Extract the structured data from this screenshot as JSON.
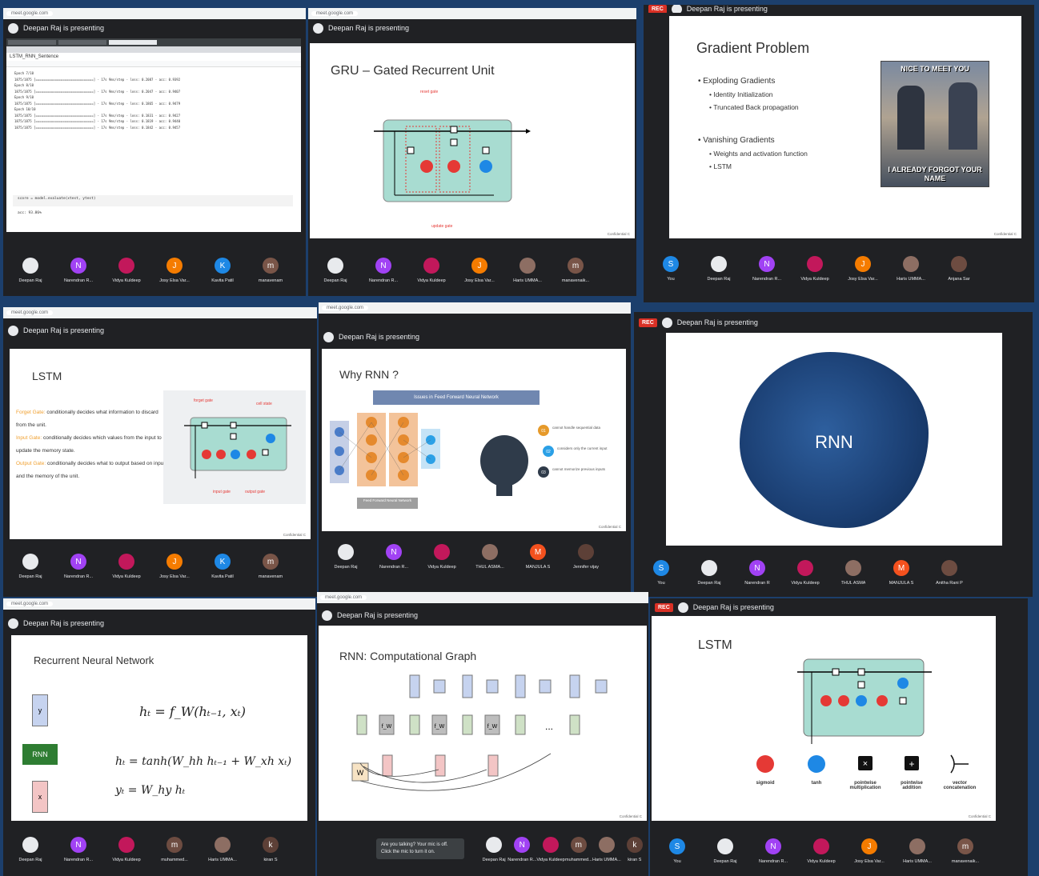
{
  "url": "meet.google.com",
  "presenting": "Deepan Raj is presenting",
  "rec": "REC",
  "confidential": "Confidential C",
  "colab": {
    "tabs": [
      "LSTM_RNN_Sentence",
      "LSTM_RNN_Sentence",
      "LSTM_RNN_Sentence"
    ],
    "notebook": "LSTM_RNN_Sentence",
    "lines": [
      "Epoch 7/10",
      "1875/1875 [==============================] - 17s 9ms/step - loss: 0.2087 - acc: 0.9392",
      "Epoch 8/10",
      "1875/1875 [==============================] - 17s 9ms/step - loss: 0.2047 - acc: 0.9407",
      "Epoch 9/10",
      "1875/1875 [==============================] - 17s 9ms/step - loss: 0.1865 - acc: 0.9479",
      "Epoch 10/10",
      "1875/1875 [==============================] - 17s 9ms/step - loss: 0.1831 - acc: 0.9427",
      "1875/1875 [==============================] - 17s 9ms/step - loss: 0.1819 - acc: 0.9440",
      "1875/1875 [==============================] - 17s 9ms/step - loss: 0.1842 - acc: 0.9457"
    ],
    "eval": "score = model.evaluate(xtest, ytest)",
    "result": "acc: 93.86%"
  },
  "slides": {
    "gru": {
      "title": "GRU – Gated Recurrent Unit",
      "reset": "reset gate",
      "update": "update gate"
    },
    "gradient": {
      "title": "Gradient Problem",
      "b1": "Exploding  Gradients",
      "b1a": "Identity Initialization",
      "b1b": "Truncated Back propagation",
      "b2": "Vanishing Gradients",
      "b2a": "Weights and activation function",
      "b2b": "LSTM",
      "meme_top": "NICE TO MEET YOU",
      "meme_bottom": "I ALREADY FORGOT YOUR NAME"
    },
    "lstm1": {
      "title": "LSTM",
      "fg": "Forget Gate:",
      "fg_t": "conditionally decides what information to discard from the unit.",
      "ig": "Input Gate:",
      "ig_t": "conditionally decides which values from the input to update the memory state.",
      "og": "Output Gate:",
      "og_t": "conditionally decides what to output based on input and the memory of the unit.",
      "forget": "forget gate",
      "cell": "cell state",
      "input": "input gate",
      "output": "output gate"
    },
    "whyrnn": {
      "title": "Why RNN ?",
      "banner": "Issues in Feed Forward Neural Network",
      "ffnn": "Feed Forward Neural Network",
      "i1": "cannot handle sequential data",
      "i2": "considers only the current input",
      "i3": "cannot memorize previous inputs",
      "n1": "01",
      "n2": "02",
      "n3": "03"
    },
    "rnn": {
      "title": "RNN"
    },
    "rnnnet": {
      "title": "Recurrent Neural Network",
      "y": "y",
      "rnn": "RNN",
      "x": "x",
      "eq1": "hₜ = f_W(hₜ₋₁, xₜ)",
      "eq2": "hₜ = tanh(W_hh hₜ₋₁ + W_xh xₜ)",
      "eq3": "yₜ = W_hy hₜ"
    },
    "compgraph": {
      "title": "RNN: Computational Graph",
      "w": "W",
      "fw": "f_W",
      "dots": "..."
    },
    "lstm2": {
      "title": "LSTM",
      "sigmoid": "sigmoid",
      "tanh": "tanh",
      "pm": "pointwise multiplication",
      "pa": "pointwise addition",
      "vc": "vector concatenation"
    }
  },
  "participants_a": [
    {
      "name": "Deepan Raj",
      "initial": "",
      "color": "#e8eaed"
    },
    {
      "name": "Narendran R...",
      "initial": "N",
      "color": "#a142f4"
    },
    {
      "name": "Vidya Kuldeep",
      "initial": "",
      "color": "#c2185b"
    },
    {
      "name": "Josy Elsa Var...",
      "initial": "J",
      "color": "#f57c00"
    },
    {
      "name": "Kavita Patil",
      "initial": "K",
      "color": "#1e88e5"
    },
    {
      "name": "manavenam",
      "initial": "m",
      "color": "#795548"
    }
  ],
  "participants_b": [
    {
      "name": "Deepan Raj",
      "initial": "",
      "color": "#e8eaed"
    },
    {
      "name": "Narendran R...",
      "initial": "N",
      "color": "#a142f4"
    },
    {
      "name": "Vidya Kuldeep",
      "initial": "",
      "color": "#c2185b"
    },
    {
      "name": "Josy Elsa Var...",
      "initial": "J",
      "color": "#f57c00"
    },
    {
      "name": "Haris UMMA...",
      "initial": "",
      "color": "#8d6e63"
    },
    {
      "name": "manavenaik...",
      "initial": "m",
      "color": "#795548"
    }
  ],
  "participants_c": [
    {
      "name": "You",
      "initial": "S",
      "color": "#1e88e5"
    },
    {
      "name": "Deepan Raj",
      "initial": "",
      "color": "#e8eaed"
    },
    {
      "name": "Narendran R...",
      "initial": "N",
      "color": "#a142f4"
    },
    {
      "name": "Vidya Kuldeep",
      "initial": "",
      "color": "#c2185b"
    },
    {
      "name": "Josy Elsa Var...",
      "initial": "J",
      "color": "#f57c00"
    },
    {
      "name": "Haris UMMA...",
      "initial": "",
      "color": "#8d6e63"
    },
    {
      "name": "Anjana Sar",
      "initial": "",
      "color": "#6d4c41"
    }
  ],
  "participants_d": [
    {
      "name": "Deepan Raj",
      "initial": "",
      "color": "#e8eaed"
    },
    {
      "name": "Narendran R...",
      "initial": "N",
      "color": "#a142f4"
    },
    {
      "name": "Vidya Kuldeep",
      "initial": "",
      "color": "#c2185b"
    },
    {
      "name": "THUL ASMA...",
      "initial": "",
      "color": "#8d6e63"
    },
    {
      "name": "MANJULA S",
      "initial": "M",
      "color": "#f4511e"
    },
    {
      "name": "Jennifer vijay",
      "initial": "",
      "color": "#5d4037"
    }
  ],
  "participants_e": [
    {
      "name": "You",
      "initial": "S",
      "color": "#1e88e5"
    },
    {
      "name": "Deepan Raj",
      "initial": "",
      "color": "#e8eaed"
    },
    {
      "name": "Narendran R",
      "initial": "N",
      "color": "#a142f4"
    },
    {
      "name": "Vidya Kuldeep",
      "initial": "",
      "color": "#c2185b"
    },
    {
      "name": "THUL ASMA",
      "initial": "",
      "color": "#8d6e63"
    },
    {
      "name": "MANJULA S",
      "initial": "M",
      "color": "#f4511e"
    },
    {
      "name": "Anitha Rani P",
      "initial": "",
      "color": "#6d4c41"
    }
  ],
  "participants_f": [
    {
      "name": "Deepan Raj",
      "initial": "",
      "color": "#e8eaed"
    },
    {
      "name": "Narendran R...",
      "initial": "N",
      "color": "#a142f4"
    },
    {
      "name": "Vidya Kuldeep",
      "initial": "",
      "color": "#c2185b"
    },
    {
      "name": "muhammed...",
      "initial": "m",
      "color": "#6d4c41"
    },
    {
      "name": "Haris UMMA...",
      "initial": "",
      "color": "#8d6e63"
    },
    {
      "name": "kiran S",
      "initial": "k",
      "color": "#5d4037"
    }
  ],
  "participants_g": [
    {
      "name": "You",
      "initial": "S",
      "color": "#1e88e5"
    },
    {
      "name": "Deepan Raj",
      "initial": "",
      "color": "#e8eaed"
    },
    {
      "name": "Narendran R...",
      "initial": "N",
      "color": "#a142f4"
    },
    {
      "name": "Vidya Kuldeep",
      "initial": "",
      "color": "#c2185b"
    },
    {
      "name": "Josy Elsa Var...",
      "initial": "J",
      "color": "#f57c00"
    },
    {
      "name": "Haris UMMA...",
      "initial": "",
      "color": "#8d6e63"
    },
    {
      "name": "manavenaik...",
      "initial": "m",
      "color": "#795548"
    }
  ],
  "mic_notice": "Are you talking? Your mic is off. Click the mic to turn it on.",
  "colors": {
    "teal": "#a8dcd1",
    "gate": "#e53935",
    "blue": "#1e88e5",
    "bg": "#1c3f6c"
  }
}
